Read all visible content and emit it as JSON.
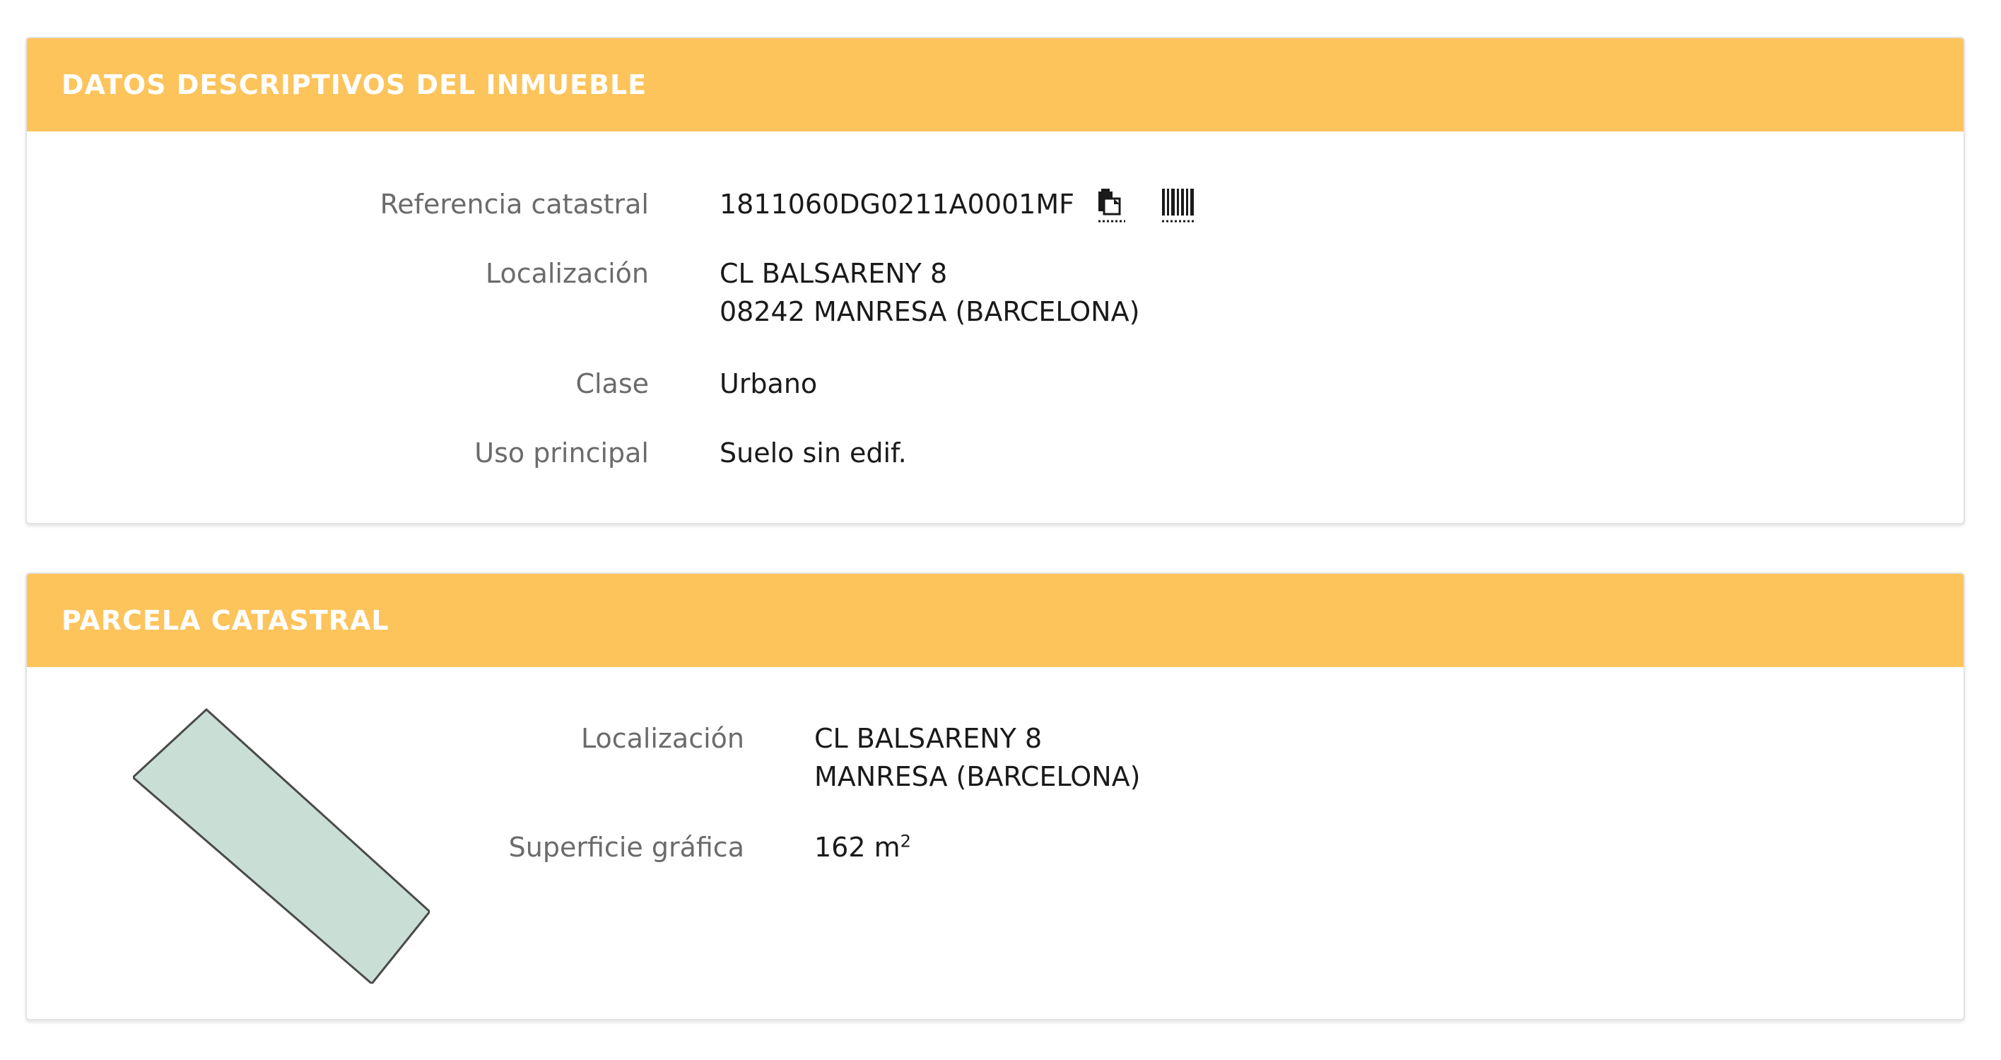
{
  "panel_inmueble": {
    "title": "DATOS DESCRIPTIVOS DEL INMUEBLE",
    "rows": [
      {
        "label": "Referencia catastral",
        "value": "1811060DG0211A0001MF"
      },
      {
        "label": "Localización",
        "value_line1": "CL BALSARENY 8",
        "value_line2": "08242 MANRESA (BARCELONA)"
      },
      {
        "label": "Clase",
        "value": "Urbano"
      },
      {
        "label": "Uso principal",
        "value": "Suelo sin edif."
      }
    ],
    "icons": {
      "copy": "copy-clipboard-icon",
      "barcode": "barcode-icon"
    }
  },
  "panel_parcela": {
    "title": "PARCELA CATASTRAL",
    "rows": [
      {
        "label": "Localización",
        "value_line1": "CL BALSARENY 8",
        "value_line2": "MANRESA (BARCELONA)"
      },
      {
        "label": "Superficie gráfica",
        "value": "162 m",
        "unit_sup": "2"
      }
    ],
    "parcel_fill": "#c9dfd6",
    "parcel_stroke": "#4a4a4a"
  },
  "colors": {
    "header": "#fdc45c",
    "label": "#6b6b6b",
    "value": "#1a1a1a"
  }
}
